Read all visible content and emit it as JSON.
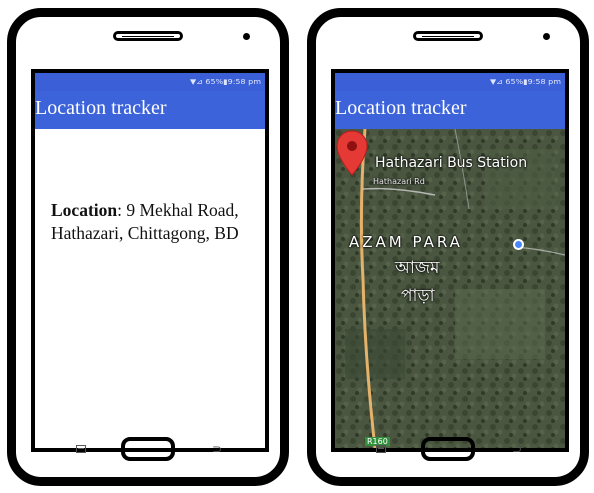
{
  "phones": [
    {
      "status_icons": "▼⊿ 65%▮9:58 pm",
      "app_title": "Location tracker",
      "location_label": "Location",
      "location_value": ": 9 Mekhal Road, Hathazari, Chittagong, BD",
      "nav": {
        "recents_icon": "recents-icon",
        "home_icon": "home-button",
        "back_icon": "⊃"
      }
    },
    {
      "status_icons": "▼⊿ 65%▮9:58 pm",
      "app_title": "Location tracker",
      "map": {
        "station_label": "Hathazari Bus Station",
        "road_label": "Hathazari Rd",
        "area_label": "AZAM PARA",
        "area_label_bn_line1": "আজম",
        "area_label_bn_line2": "পাড়া",
        "route_label": "R160",
        "pin_icon": "map-pin-icon",
        "current_location_icon": "current-location-dot",
        "pin_color": "#e53935",
        "dot_color": "#4a86ff"
      },
      "nav": {
        "recents_icon": "recents-icon",
        "home_icon": "home-button",
        "back_icon": "⊃"
      }
    }
  ],
  "colors": {
    "app_bar": "#3c63d9",
    "status_bar": "#3a5fd6",
    "phone_frame": "#000000"
  }
}
